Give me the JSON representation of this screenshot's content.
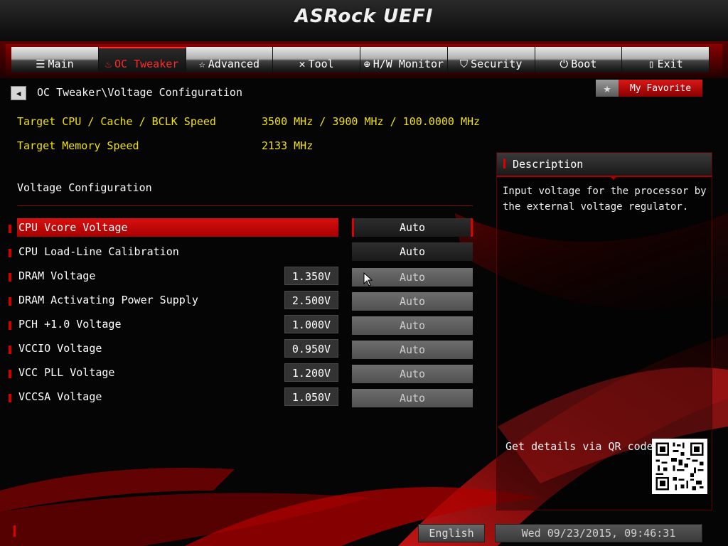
{
  "app": {
    "brand": "ASRock UEFI"
  },
  "colors": {
    "accent": "#d00000",
    "highlight_text": "#f0e100",
    "panel_bg": "#050505"
  },
  "nav": {
    "tabs": [
      {
        "label": "Main",
        "icon": "list-icon",
        "glyph": "☰",
        "active": false
      },
      {
        "label": "OC Tweaker",
        "icon": "flame-icon",
        "glyph": "♨",
        "active": true
      },
      {
        "label": "Advanced",
        "icon": "star-icon",
        "glyph": "☆",
        "active": false
      },
      {
        "label": "Tool",
        "icon": "tools-icon",
        "glyph": "✕",
        "active": false
      },
      {
        "label": "H/W Monitor",
        "icon": "monitor-icon",
        "glyph": "⊕",
        "active": false
      },
      {
        "label": "Security",
        "icon": "shield-icon",
        "glyph": "⛉",
        "active": false
      },
      {
        "label": "Boot",
        "icon": "power-icon",
        "glyph": "⏻",
        "active": false
      },
      {
        "label": "Exit",
        "icon": "door-icon",
        "glyph": "▯",
        "active": false
      }
    ]
  },
  "breadcrumb": "OC Tweaker\\Voltage Configuration",
  "favorite": {
    "label": "My Favorite"
  },
  "info": {
    "cpu_label": "Target CPU / Cache / BCLK Speed",
    "cpu_value": "3500 MHz / 3900 MHz / 100.0000 MHz",
    "mem_label": "Target Memory Speed",
    "mem_value": "2133 MHz"
  },
  "section_title": "Voltage Configuration",
  "settings": [
    {
      "label": "CPU Vcore Voltage",
      "current": "",
      "value": "Auto",
      "selected": true,
      "style": "dark"
    },
    {
      "label": "CPU Load-Line Calibration",
      "current": "",
      "value": "Auto",
      "selected": false,
      "style": "dark"
    },
    {
      "label": "DRAM Voltage",
      "current": "1.350V",
      "value": "Auto",
      "selected": false,
      "style": "light"
    },
    {
      "label": "DRAM Activating Power Supply",
      "current": "2.500V",
      "value": "Auto",
      "selected": false,
      "style": "light"
    },
    {
      "label": "PCH +1.0 Voltage",
      "current": "1.000V",
      "value": "Auto",
      "selected": false,
      "style": "light"
    },
    {
      "label": "VCCIO Voltage",
      "current": "0.950V",
      "value": "Auto",
      "selected": false,
      "style": "light"
    },
    {
      "label": "VCC PLL Voltage",
      "current": "1.200V",
      "value": "Auto",
      "selected": false,
      "style": "light"
    },
    {
      "label": "VCCSA Voltage",
      "current": "1.050V",
      "value": "Auto",
      "selected": false,
      "style": "light"
    }
  ],
  "description": {
    "title": "Description",
    "text": "Input voltage for the processor by the external voltage regulator.",
    "qr_label": "Get details via QR code"
  },
  "footer": {
    "language": "English",
    "datetime": "Wed 09/23/2015, 09:46:31"
  }
}
